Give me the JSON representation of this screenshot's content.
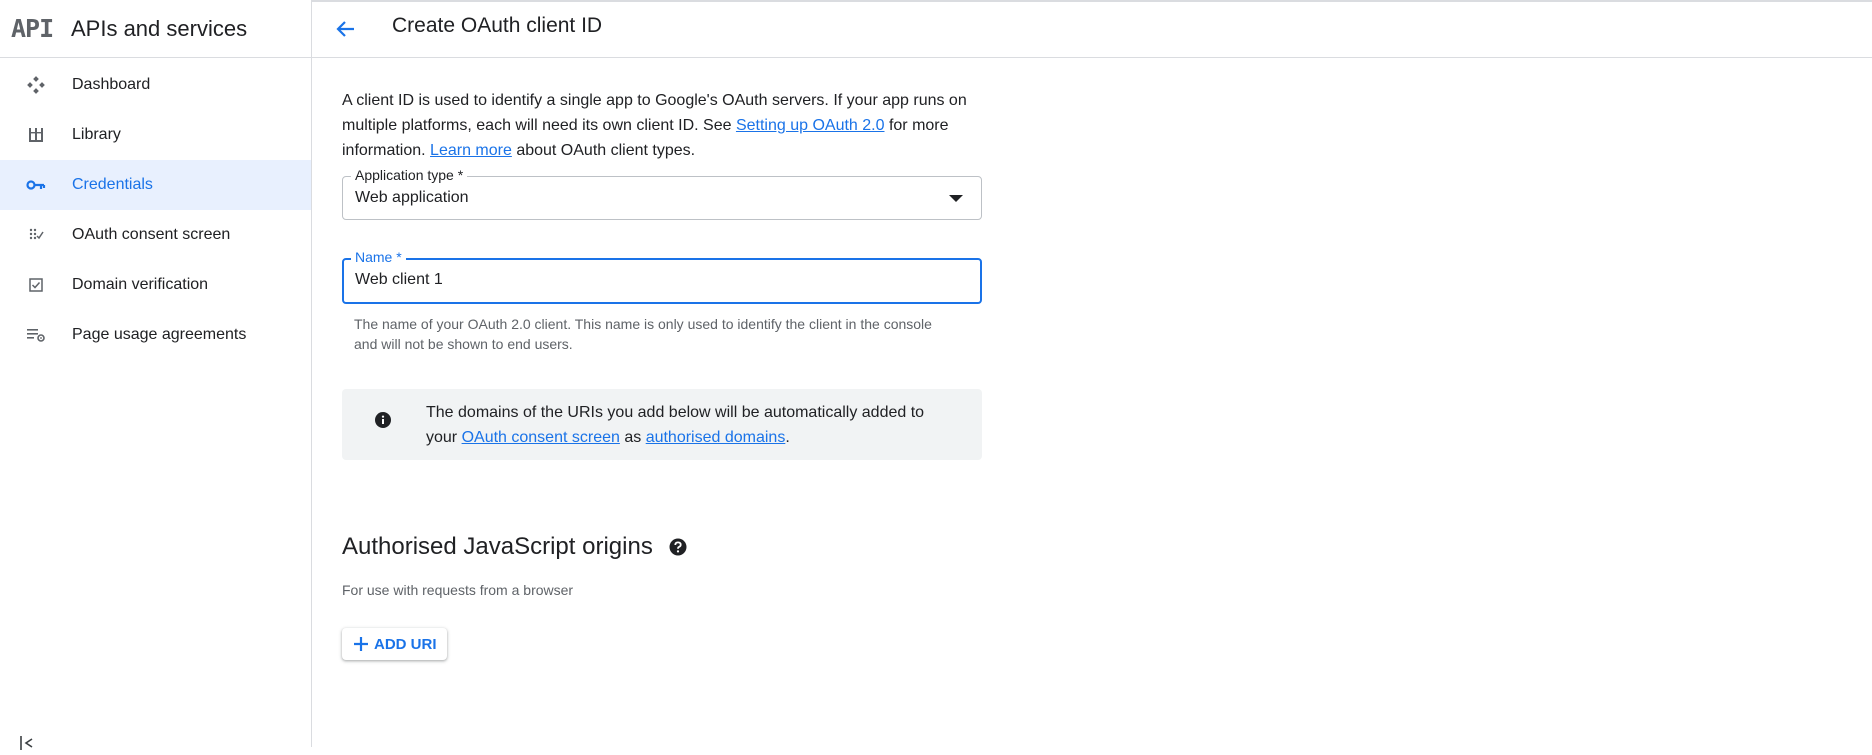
{
  "sidebar": {
    "logo": "API",
    "title": "APIs and services",
    "items": [
      {
        "label": "Dashboard",
        "icon": "dashboard-icon"
      },
      {
        "label": "Library",
        "icon": "library-icon"
      },
      {
        "label": "Credentials",
        "icon": "key-icon",
        "active": true
      },
      {
        "label": "OAuth consent screen",
        "icon": "consent-icon"
      },
      {
        "label": "Domain verification",
        "icon": "checkbox-icon"
      },
      {
        "label": "Page usage agreements",
        "icon": "settings-list-icon"
      }
    ]
  },
  "header": {
    "title": "Create OAuth client ID"
  },
  "intro": {
    "text1": "A client ID is used to identify a single app to Google's OAuth servers. If your app runs on multiple platforms, each will need its own client ID. See ",
    "link1": "Setting up OAuth 2.0",
    "text2": " for more information. ",
    "link2": "Learn more",
    "text3": " about OAuth client types."
  },
  "application_type": {
    "label": "Application type *",
    "value": "Web application"
  },
  "name_field": {
    "label": "Name *",
    "value": "Web client 1",
    "hint": "The name of your OAuth 2.0 client. This name is only used to identify the client in the console and will not be shown to end users."
  },
  "info": {
    "text1": "The domains of the URIs you add below will be automatically added to your ",
    "link1": "OAuth consent screen",
    "text2": " as ",
    "link2": "authorised domains",
    "text3": "."
  },
  "js_origins": {
    "title": "Authorised JavaScript origins",
    "subtitle": "For use with requests from a browser",
    "add_button": "ADD URI"
  },
  "colors": {
    "accent": "#1a73e8",
    "active_bg": "#e8f0fe",
    "info_bg": "#f1f3f4"
  }
}
